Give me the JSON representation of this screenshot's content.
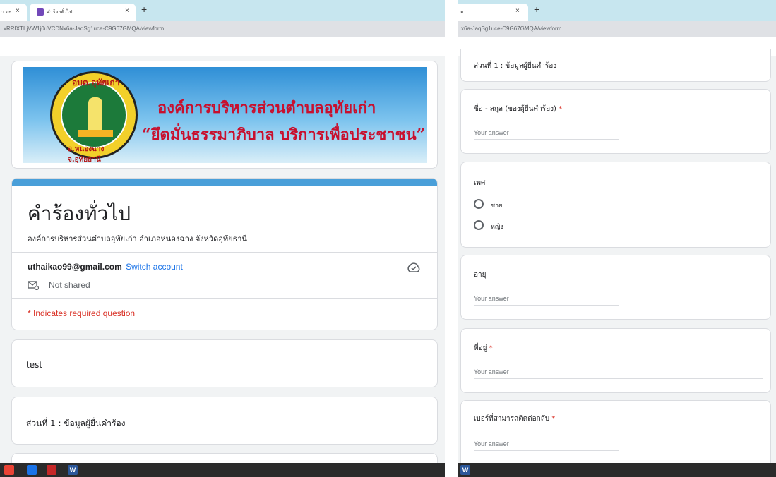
{
  "left": {
    "tab_prev_label": "า อะ",
    "tab_label": "คำร้องทั่วไป",
    "new_tab_label": "+",
    "close_label": "×",
    "address": "xRRIXTLjVW1j0uVCDNx6a-JaqSg1uce-C9G67GMQA/viewform",
    "banner": {
      "line1": "องค์การบริหารส่วนตำบลอุทัยเก่า",
      "line2": "“ยึดมั่นธรรมาภิบาล  บริการเพื่อประชาชน”",
      "seal_top": "อบต.อุทัยเก่า",
      "seal_bottom": "อ.หนองฉาง จ.อุทัยธานี"
    },
    "form": {
      "title": "คำร้องทั่วไป",
      "description": "องค์การบริหารส่วนตำบลอุทัยเก่า อำเภอหนองฉาง จังหวัดอุทัยธานี",
      "email": "uthaikao99@gmail.com",
      "switch_account": "Switch account",
      "not_shared": "Not shared",
      "required_note": "* Indicates required question"
    },
    "sections": [
      {
        "text": "test"
      },
      {
        "text": "ส่วนที่ 1 : ข้อมูลผู้ยื่นคำร้อง"
      }
    ]
  },
  "right": {
    "tab_label": "ม",
    "new_tab_label": "+",
    "close_label": "×",
    "address": "x6a-JaqSg1uce-C9G67GMQA/viewform",
    "section_title": "ส่วนที่ 1 : ข้อมูลผู้ยื่นคำร้อง",
    "questions": [
      {
        "label": "ชื่อ - สกุล (ของผู้ยื่นคำร้อง)",
        "required": "*",
        "placeholder": "Your answer"
      },
      {
        "label": "เพศ",
        "options": [
          "ชาย",
          "หญิง"
        ]
      },
      {
        "label": "อายุ",
        "placeholder": "Your answer"
      },
      {
        "label": "ที่อยู่",
        "required": "*",
        "placeholder": "Your answer"
      },
      {
        "label": "เบอร์ที่สามารถติดต่อกลับ",
        "required": "*",
        "placeholder": "Your answer"
      }
    ]
  },
  "taskbar": {
    "icons": [
      "chrome-icon",
      "edge-icon",
      "acrobat-icon",
      "word-icon"
    ],
    "word_label": "W"
  },
  "colors": {
    "accent": "#4a9fd9",
    "link": "#1a73e8",
    "required": "#d93025",
    "banner_text": "#c8102e"
  }
}
